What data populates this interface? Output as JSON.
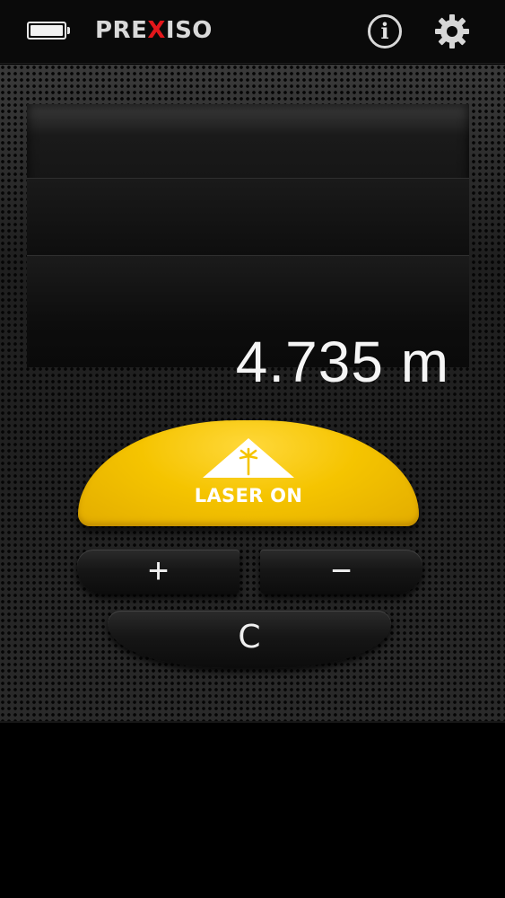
{
  "header": {
    "brand_prefix": "PRE",
    "brand_x": "X",
    "brand_suffix": "ISO",
    "info_label": "i",
    "battery_icon": "battery-full-icon",
    "settings_icon": "gear-icon"
  },
  "display": {
    "reading": "4.735 m"
  },
  "controls": {
    "laser_label": "LASER ON",
    "plus_label": "+",
    "minus_label": "−",
    "clear_label": "C"
  },
  "colors": {
    "accent_yellow": "#f5c400",
    "brand_red": "#e3171b",
    "background": "#000000"
  }
}
